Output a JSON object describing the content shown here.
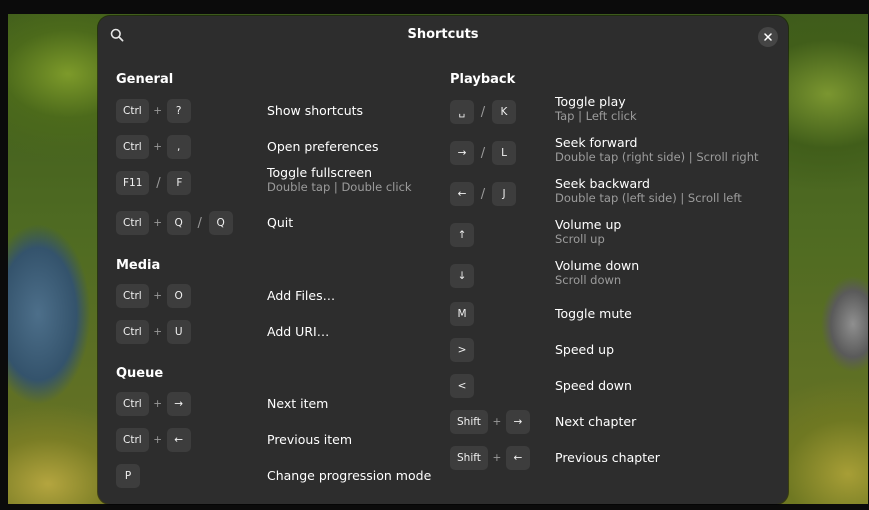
{
  "window": {
    "title": "Shortcuts",
    "search_icon": "search-icon",
    "close_icon": "close-icon"
  },
  "sections": {
    "general": {
      "title": "General",
      "items": [
        {
          "keys": [
            "Ctrl",
            "+",
            "?"
          ],
          "title": "Show shortcuts"
        },
        {
          "keys": [
            "Ctrl",
            "+",
            ","
          ],
          "title": "Open preferences"
        },
        {
          "keys": [
            "F11",
            "/",
            "F"
          ],
          "title": "Toggle fullscreen",
          "subtitle": "Double tap | Double click"
        },
        {
          "keys": [
            "Ctrl",
            "+",
            "Q",
            "/",
            "Q"
          ],
          "title": "Quit"
        }
      ]
    },
    "media": {
      "title": "Media",
      "items": [
        {
          "keys": [
            "Ctrl",
            "+",
            "O"
          ],
          "title": "Add Files…"
        },
        {
          "keys": [
            "Ctrl",
            "+",
            "U"
          ],
          "title": "Add URI…"
        }
      ]
    },
    "queue": {
      "title": "Queue",
      "items": [
        {
          "keys": [
            "Ctrl",
            "+",
            "→"
          ],
          "title": "Next item"
        },
        {
          "keys": [
            "Ctrl",
            "+",
            "←"
          ],
          "title": "Previous item"
        },
        {
          "keys": [
            "P"
          ],
          "title": "Change progression mode"
        }
      ]
    },
    "playback": {
      "title": "Playback",
      "items": [
        {
          "keys": [
            "␣",
            "/",
            "K"
          ],
          "title": "Toggle play",
          "subtitle": "Tap | Left click"
        },
        {
          "keys": [
            "→",
            "/",
            "L"
          ],
          "title": "Seek forward",
          "subtitle": "Double tap (right side) | Scroll right"
        },
        {
          "keys": [
            "←",
            "/",
            "J"
          ],
          "title": "Seek backward",
          "subtitle": "Double tap (left side) | Scroll left"
        },
        {
          "keys": [
            "↑"
          ],
          "title": "Volume up",
          "subtitle": "Scroll up"
        },
        {
          "keys": [
            "↓"
          ],
          "title": "Volume down",
          "subtitle": "Scroll down"
        },
        {
          "keys": [
            "M"
          ],
          "title": "Toggle mute"
        },
        {
          "keys": [
            ">"
          ],
          "title": "Speed up"
        },
        {
          "keys": [
            "<"
          ],
          "title": "Speed down"
        },
        {
          "keys": [
            "Shift",
            "+",
            "→"
          ],
          "title": "Next chapter"
        },
        {
          "keys": [
            "Shift",
            "+",
            "←"
          ],
          "title": "Previous chapter"
        }
      ]
    }
  }
}
